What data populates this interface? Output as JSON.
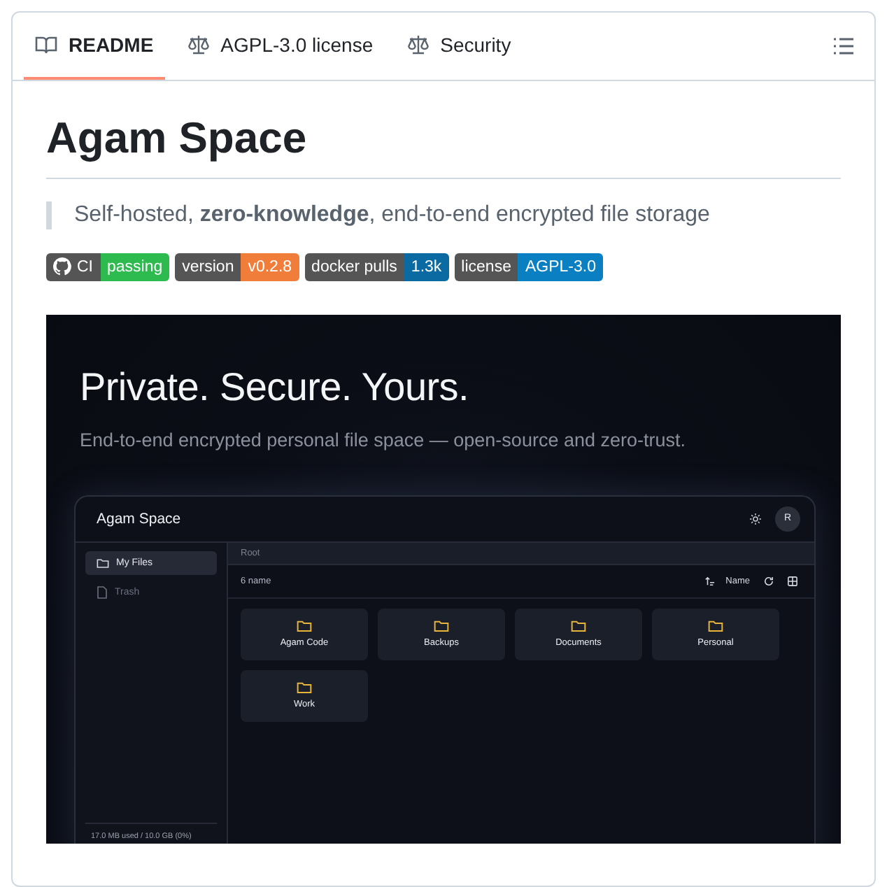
{
  "tabs": [
    {
      "kind": "book",
      "label": "README",
      "selected": true
    },
    {
      "kind": "scale",
      "label": "AGPL-3.0 license",
      "selected": false
    },
    {
      "kind": "scale",
      "label": "Security",
      "selected": false
    }
  ],
  "readme": {
    "title": "Agam Space",
    "tagline": "Self-hosted, **zero-knowledge**, end-to-end encrypted file storage",
    "badges": [
      {
        "kind": "github",
        "label": "CI",
        "value": "passing",
        "color": "#2dba4e"
      },
      {
        "kind": "plain",
        "label": "version",
        "value": "v0.2.8",
        "color": "#f07d3a"
      },
      {
        "kind": "plain",
        "label": "docker pulls",
        "value": "1.3k",
        "color": "#0a6aa1"
      },
      {
        "kind": "plain",
        "label": "license",
        "value": "AGPL-3.0",
        "color": "#0a7fc2"
      }
    ],
    "screenshot": {
      "headline": "Private. Secure. Yours.",
      "subtitle": "End-to-end encrypted personal file space — open-source and zero-trust.",
      "app": {
        "title": "Agam Space",
        "avatar": "R",
        "sidebar": [
          {
            "kind": "folder",
            "label": "My Files",
            "selected": true
          },
          {
            "kind": "file",
            "label": "Trash",
            "selected": false
          }
        ],
        "breadcrumb": "Root",
        "count": "6 name",
        "sort": "Name",
        "folders": [
          "Agam Code",
          "Backups",
          "Documents",
          "Personal",
          "Work"
        ],
        "storage": "17.0 MB used / 10.0 GB  (0%)"
      }
    }
  }
}
